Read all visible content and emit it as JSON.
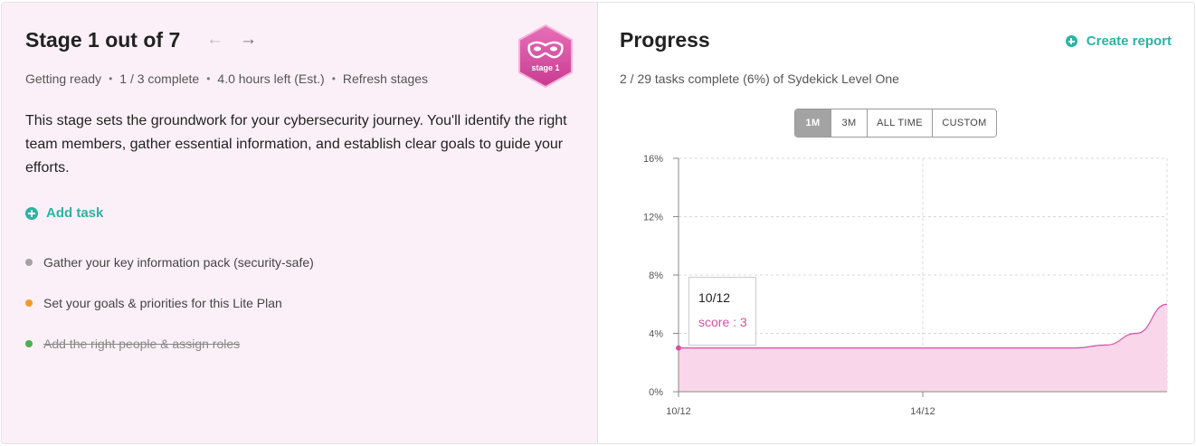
{
  "stage": {
    "title": "Stage 1 out of 7",
    "prev_icon": "arrow-left-icon",
    "next_icon": "arrow-right-icon",
    "meta": {
      "status": "Getting ready",
      "complete": "1 / 3 complete",
      "time_left": "4.0 hours left (Est.)",
      "refresh_label": "Refresh stages"
    },
    "badge": {
      "label": "stage 1",
      "icon": "mask-icon",
      "color": "#d94fa3"
    },
    "description": "This stage sets the groundwork for your cybersecurity journey. You'll identify the right team members, gather essential information, and establish clear goals to guide your efforts.",
    "add_task_label": "Add task",
    "tasks": [
      {
        "label": "Gather your key information pack (security-safe)",
        "status_color": "#a3a3a3",
        "done": false
      },
      {
        "label": "Set your goals & priorities for this Lite Plan",
        "status_color": "#f29a2e",
        "done": false
      },
      {
        "label": "Add the right people & assign roles",
        "status_color": "#4caf50",
        "done": true
      }
    ]
  },
  "progress": {
    "title": "Progress",
    "create_report_label": "Create report",
    "summary": "2 / 29 tasks complete (6%) of Sydekick Level One",
    "ranges": [
      {
        "label": "1M",
        "active": true
      },
      {
        "label": "3M",
        "active": false
      },
      {
        "label": "ALL TIME",
        "active": false
      },
      {
        "label": "CUSTOM",
        "active": false
      }
    ],
    "tooltip": {
      "date": "10/12",
      "score": "score : 3"
    }
  },
  "chart_data": {
    "type": "area",
    "x_tick_labels": [
      "10/12",
      "14/12"
    ],
    "y_tick_labels": [
      "0%",
      "4%",
      "8%",
      "12%",
      "16%"
    ],
    "ylim": [
      0,
      16
    ],
    "grid": true,
    "series_color": "#d94fa3",
    "fill_color": "#f9d6ea",
    "points": [
      {
        "x": 0,
        "y": 3
      },
      {
        "x": 1,
        "y": 3
      },
      {
        "x": 2,
        "y": 3
      },
      {
        "x": 3,
        "y": 3
      },
      {
        "x": 4,
        "y": 3
      },
      {
        "x": 5,
        "y": 3
      },
      {
        "x": 6,
        "y": 3
      },
      {
        "x": 7,
        "y": 3
      },
      {
        "x": 8,
        "y": 3
      },
      {
        "x": 9,
        "y": 3
      },
      {
        "x": 10,
        "y": 3
      },
      {
        "x": 11,
        "y": 3
      },
      {
        "x": 12,
        "y": 3
      },
      {
        "x": 13,
        "y": 3
      },
      {
        "x": 14,
        "y": 3.2
      },
      {
        "x": 15,
        "y": 4
      },
      {
        "x": 16,
        "y": 6
      }
    ],
    "x_tick_positions": [
      0,
      8
    ]
  }
}
